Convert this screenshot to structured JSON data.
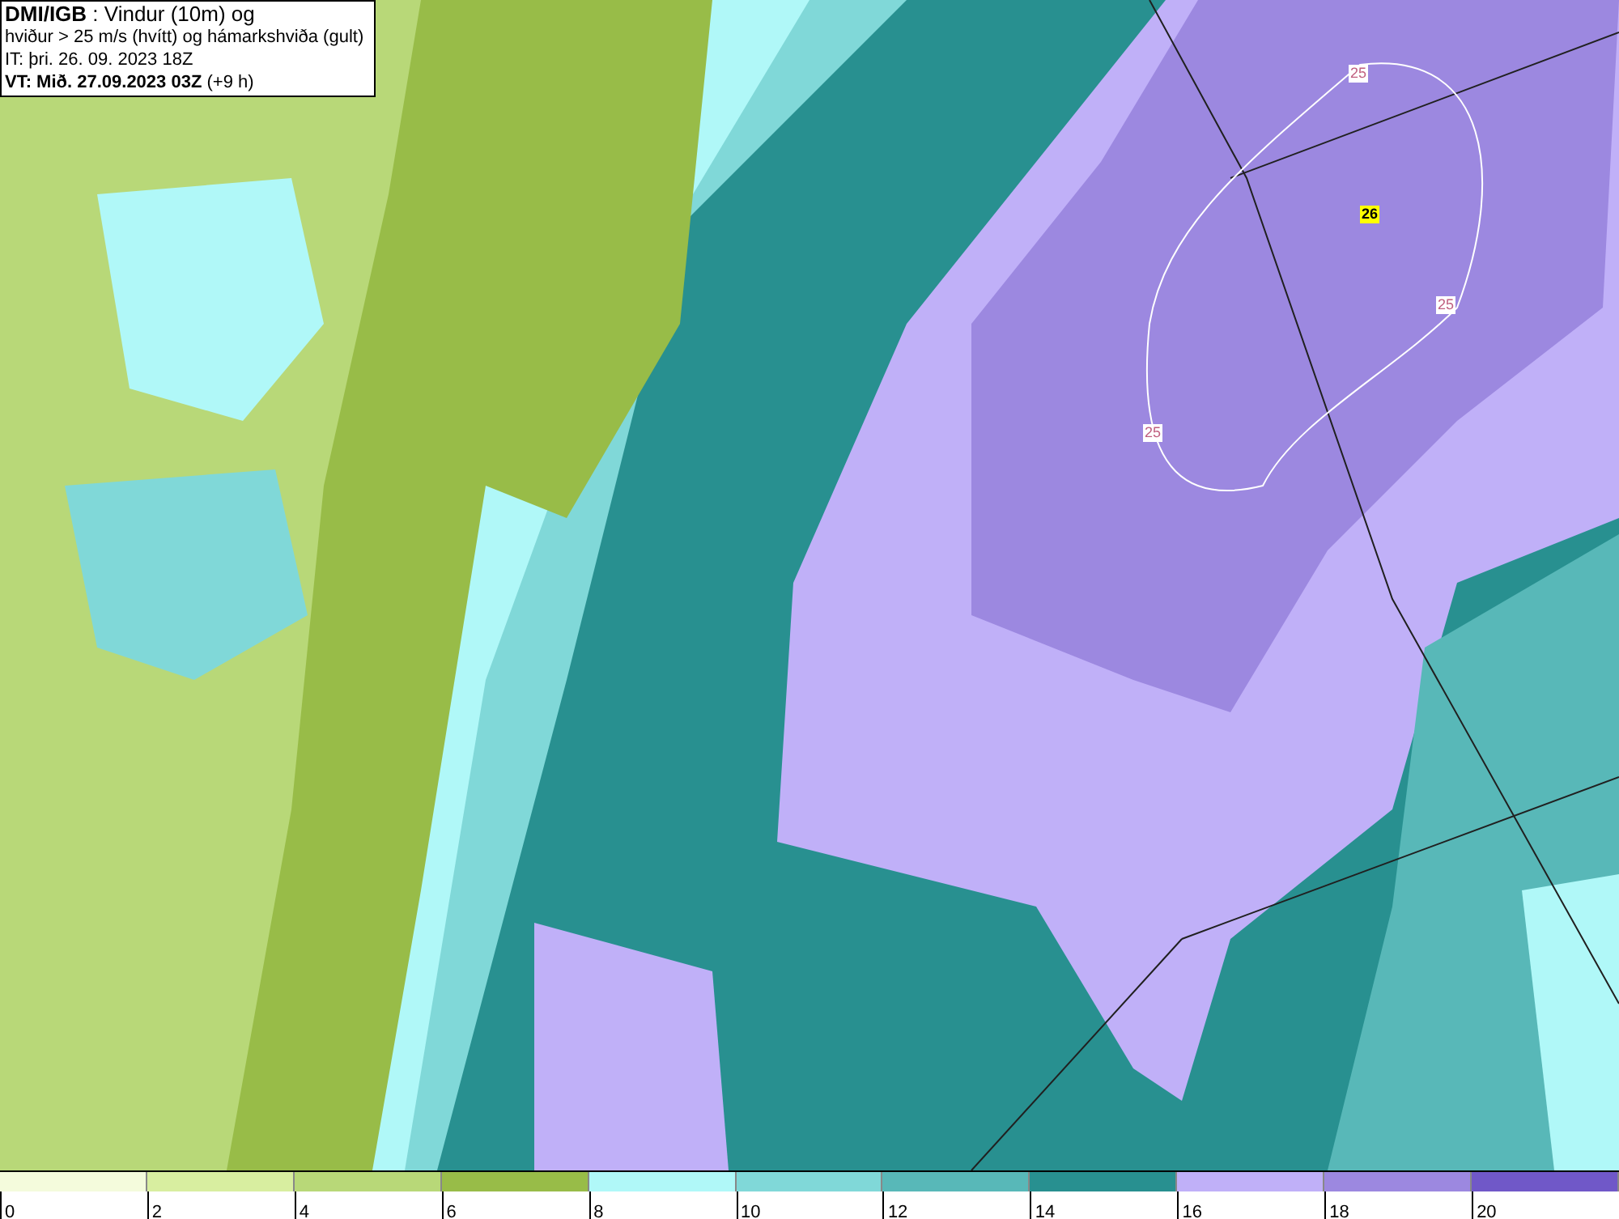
{
  "header": {
    "lines": [
      "**DMI/IGB** : Vindur (10m) og",
      "hviður > 25 m/s (hvítt) og hámarkshviða (gult)",
      "IT: þri. 26. 09. 2023 18Z",
      "**VT: Mið. 27.09.2023 03Z** (+9 h)"
    ]
  },
  "map": {
    "contour_labels": [
      {
        "text": "25",
        "kind": "gust"
      },
      {
        "text": "26",
        "kind": "max"
      },
      {
        "text": "25",
        "kind": "gust"
      },
      {
        "text": "25",
        "kind": "gust"
      }
    ]
  },
  "legend": {
    "bins": [
      {
        "color": "#f4fbdc"
      },
      {
        "color": "#d8eea0"
      },
      {
        "color": "#b8d878"
      },
      {
        "color": "#98bc48"
      },
      {
        "color": "#b0f8f8"
      },
      {
        "color": "#80d8d8"
      },
      {
        "color": "#58b8b8"
      },
      {
        "color": "#289090"
      },
      {
        "color": "#c0b0f8"
      },
      {
        "color": "#9c88e0"
      },
      {
        "color": "#7058c8"
      }
    ],
    "ticks": [
      "0",
      "2",
      "4",
      "6",
      "8",
      "10",
      "12",
      "14",
      "16",
      "18",
      "20"
    ]
  }
}
